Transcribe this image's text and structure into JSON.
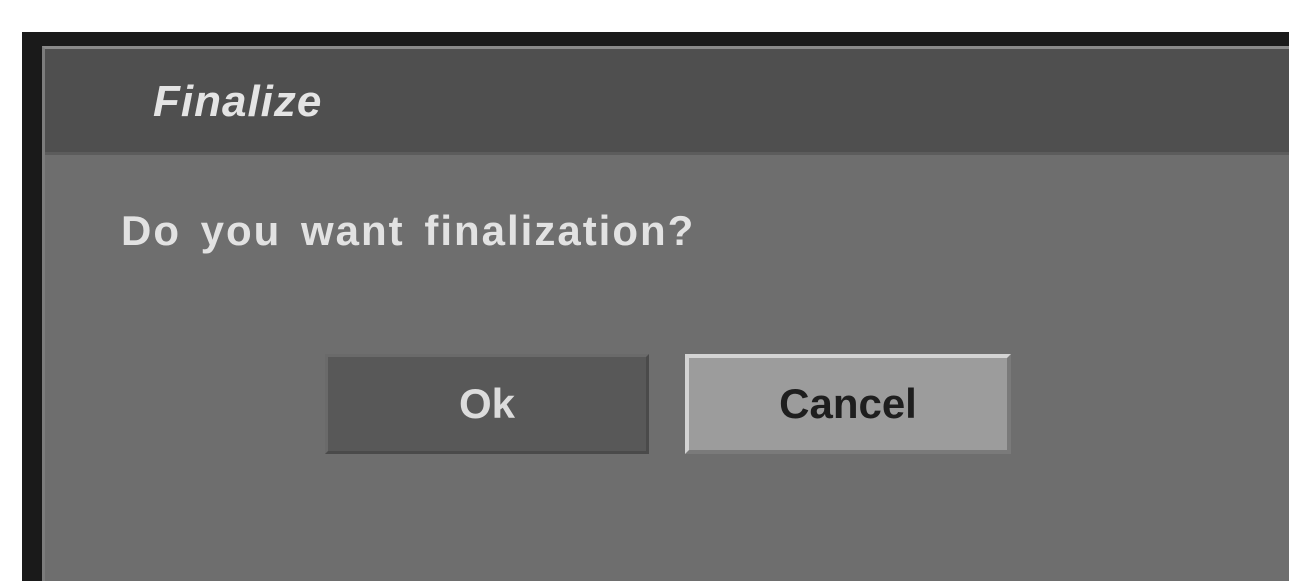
{
  "dialog": {
    "title": "Finalize",
    "message": "Do you want finalization?",
    "buttons": {
      "ok_label": "Ok",
      "cancel_label": "Cancel"
    },
    "selected_button": "Cancel"
  },
  "colors": {
    "title_bar": "#4f4f4f",
    "dialog_body": "#6e6e6e",
    "ok_button": "#585858",
    "cancel_button_highlight": "#9c9c9c"
  }
}
